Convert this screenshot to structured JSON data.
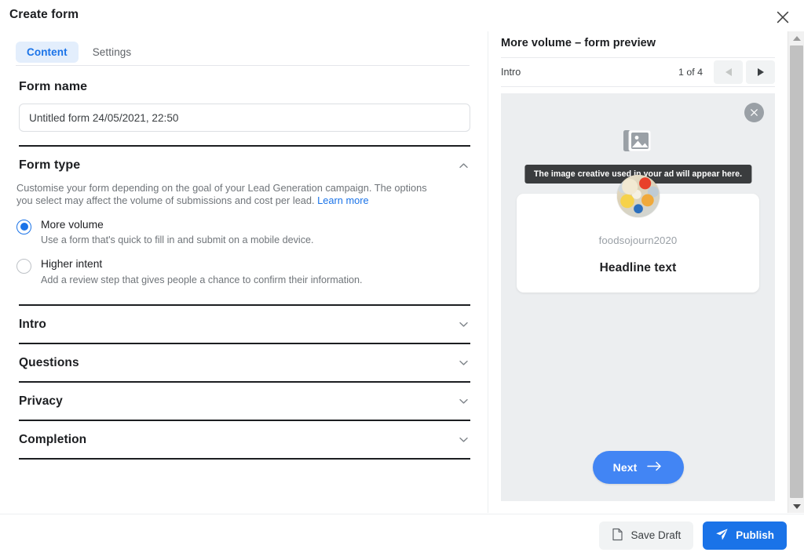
{
  "dialog": {
    "title": "Create form",
    "close_icon": "close-icon"
  },
  "tabs": [
    {
      "label": "Content",
      "active": true
    },
    {
      "label": "Settings",
      "active": false
    }
  ],
  "form_name": {
    "heading": "Form name",
    "value": "Untitled form 24/05/2021, 22:50",
    "placeholder": "Untitled form"
  },
  "form_type": {
    "heading": "Form type",
    "collapse_icon": "chevron-up-icon",
    "description": "Customise your form depending on the goal of your Lead Generation campaign. The options you select may affect the volume of submissions and cost per lead.",
    "learn_more": "Learn more",
    "options": [
      {
        "label": "More volume",
        "sub": "Use a form that's quick to fill in and submit on a mobile device.",
        "selected": true
      },
      {
        "label": "Higher intent",
        "sub": "Add a review step that gives people a chance to confirm their information.",
        "selected": false
      }
    ]
  },
  "sections": [
    {
      "label": "Intro",
      "chevron": "chevron-down-icon"
    },
    {
      "label": "Questions",
      "chevron": "chevron-down-icon"
    },
    {
      "label": "Privacy",
      "chevron": "chevron-down-icon"
    },
    {
      "label": "Completion",
      "chevron": "chevron-down-icon"
    }
  ],
  "preview": {
    "title": "More volume – form preview",
    "step_label": "Intro",
    "counter": "1 of 4",
    "prev_icon": "triangle-left-icon",
    "next_icon": "triangle-right-icon",
    "card_close_icon": "close-circle-icon",
    "image_placeholder_icon": "images-icon",
    "tooltip": "The image creative used in your ad will appear here.",
    "avatar_icon": "avatar",
    "username": "foodsojourn2020",
    "headline": "Headline text",
    "next_button": "Next",
    "next_button_icon": "arrow-right-icon"
  },
  "scrollbar": {
    "up_icon": "scroll-up-arrow-icon",
    "down_icon": "scroll-down-arrow-icon"
  },
  "footer": {
    "save_draft": "Save Draft",
    "save_draft_icon": "document-icon",
    "publish": "Publish",
    "publish_icon": "paper-plane-icon"
  },
  "colors": {
    "accent_blue": "#1a73e8",
    "preview_blue": "#4285f4",
    "tab_active_bg": "#e3eefc",
    "panel_gray": "#eceef0",
    "tooltip_bg": "#3a3c3e"
  }
}
